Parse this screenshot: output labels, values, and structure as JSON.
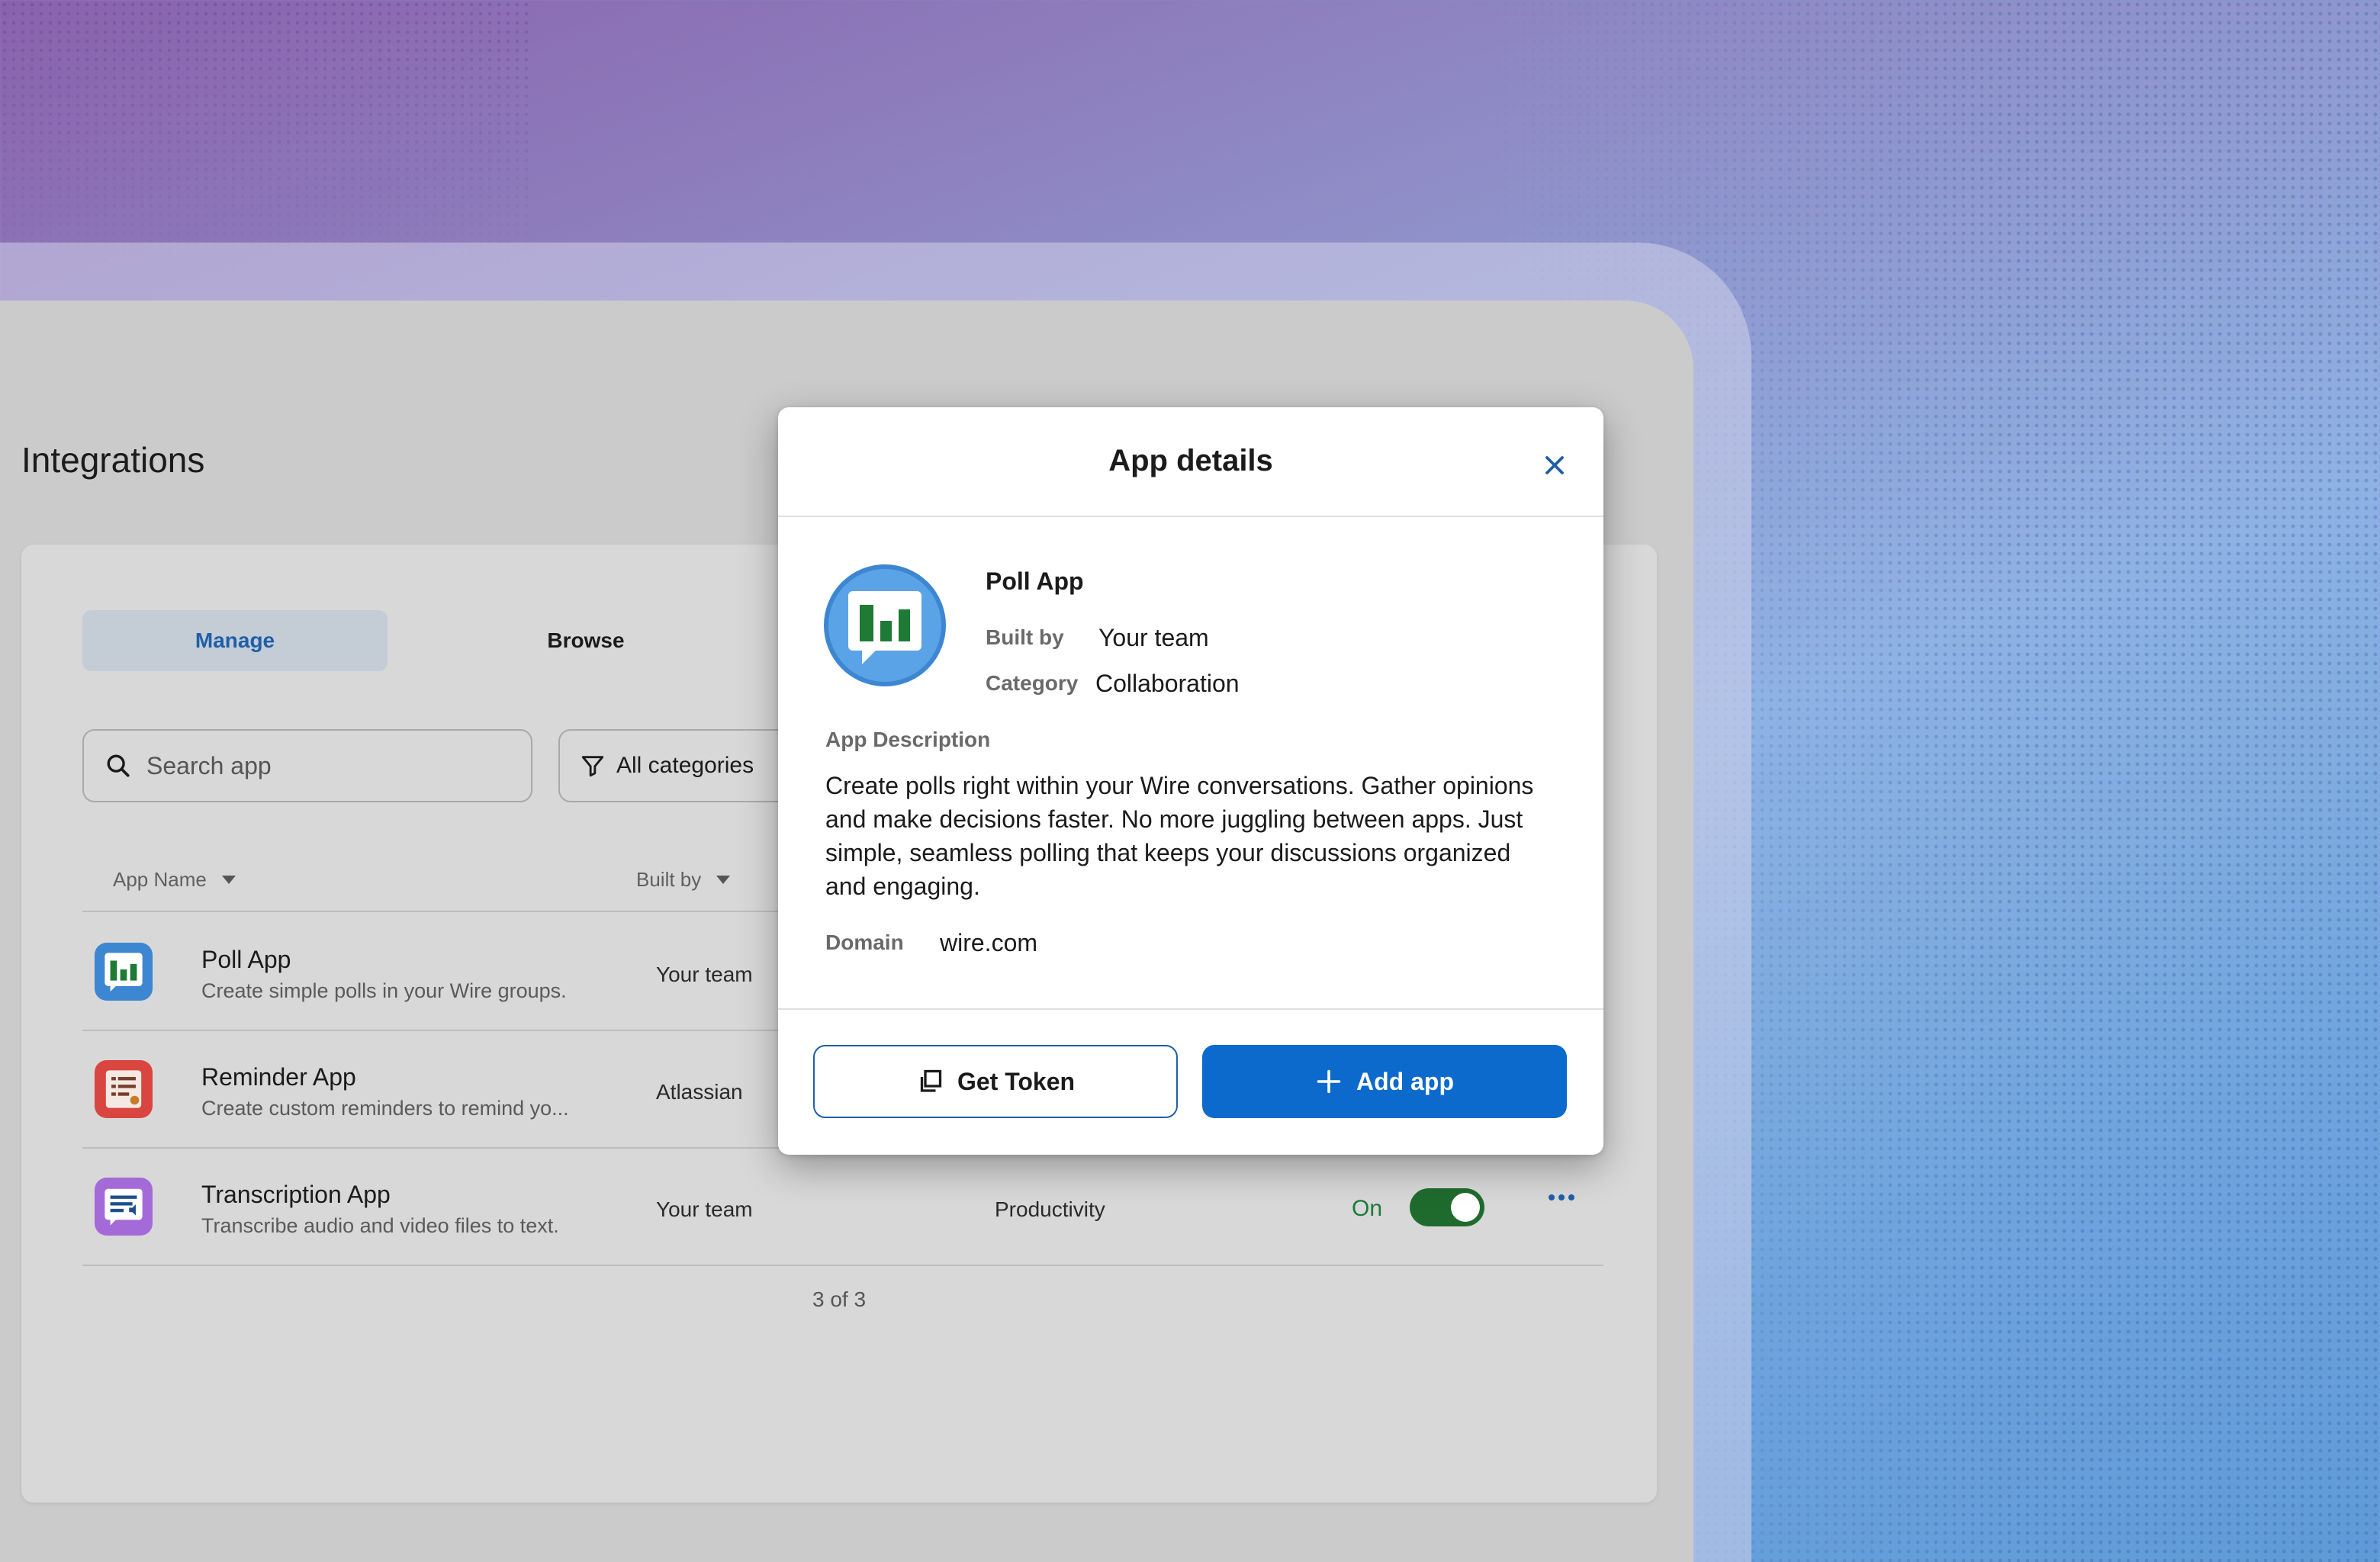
{
  "page": {
    "title": "Integrations"
  },
  "tabs": [
    {
      "label": "Manage",
      "active": true
    },
    {
      "label": "Browse",
      "active": false
    }
  ],
  "search": {
    "placeholder": "Search app",
    "icon": "search-icon"
  },
  "filter": {
    "label": "All categories",
    "icon": "filter-icon"
  },
  "table": {
    "columns": [
      "App Name",
      "Built by"
    ],
    "rows": [
      {
        "name": "Poll App",
        "description": "Create simple polls in your Wire groups.",
        "built_by": "Your team",
        "category": "",
        "icon": "poll-chart-icon",
        "icon_color": "#3d86d2"
      },
      {
        "name": "Reminder App",
        "description": "Create custom reminders to remind yo...",
        "built_by": "Atlassian",
        "category": "",
        "icon": "reminder-list-icon",
        "icon_color": "#d9453f"
      },
      {
        "name": "Transcription App",
        "description": "Transcribe audio and video files to text.",
        "built_by": "Your team",
        "category": "Productivity",
        "status": "On",
        "toggle_on": true,
        "icon": "transcription-icon",
        "icon_color": "#a46ad8"
      }
    ],
    "count": "3 of 3"
  },
  "modal": {
    "title": "App details",
    "app_name": "Poll App",
    "built_by_label": "Built by",
    "built_by": "Your team",
    "category_label": "Category",
    "category": "Collaboration",
    "description_label": "App Description",
    "description": "Create polls right within your Wire conversations. Gather opinions and make decisions faster. No more juggling between apps. Just simple, seamless polling that keeps your discussions organized and engaging.",
    "domain_label": "Domain",
    "domain": "wire.com",
    "get_token_label": "Get Token",
    "add_app_label": "Add app"
  },
  "colors": {
    "accent": "#0b6acc",
    "toggle_on": "#1f6b2e",
    "status_on_text": "#1b7a3a"
  }
}
